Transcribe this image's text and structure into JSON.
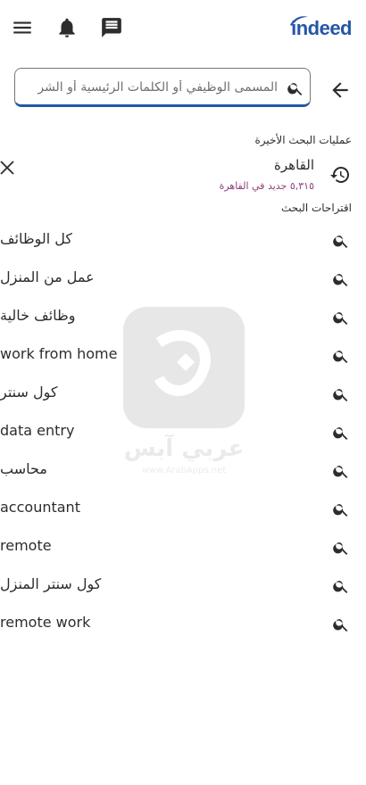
{
  "header": {
    "logo_text": "indeed",
    "brand_color": "#2557a7",
    "icons": [
      "hamburger-menu-icon",
      "bell-icon",
      "message-icon"
    ]
  },
  "search": {
    "placeholder": "المسمى الوظيفي أو الكلمات الرئيسية أو الشر",
    "value": ""
  },
  "recent": {
    "label": "عمليات البحث الأخيرة",
    "items": [
      {
        "title": "القاهرة",
        "subtitle": "٥,٣١٥ جديد في القاهرة"
      }
    ]
  },
  "suggestions": {
    "label": "اقتراحات البحث",
    "items": [
      {
        "text": "كل الوظائف",
        "rtl": true
      },
      {
        "text": "عمل من المنزل",
        "rtl": true
      },
      {
        "text": "وظائف خالية",
        "rtl": true
      },
      {
        "text": "work from home",
        "rtl": false
      },
      {
        "text": "كول سنتر",
        "rtl": true
      },
      {
        "text": "data entry",
        "rtl": false
      },
      {
        "text": "محاسب",
        "rtl": true
      },
      {
        "text": "accountant",
        "rtl": false
      },
      {
        "text": "remote",
        "rtl": false
      },
      {
        "text": "كول سنتر المنزل",
        "rtl": true
      },
      {
        "text": "remote work",
        "rtl": false
      }
    ]
  },
  "watermark": {
    "name": "عربي آبس",
    "url": "www.ArabApps.net"
  }
}
